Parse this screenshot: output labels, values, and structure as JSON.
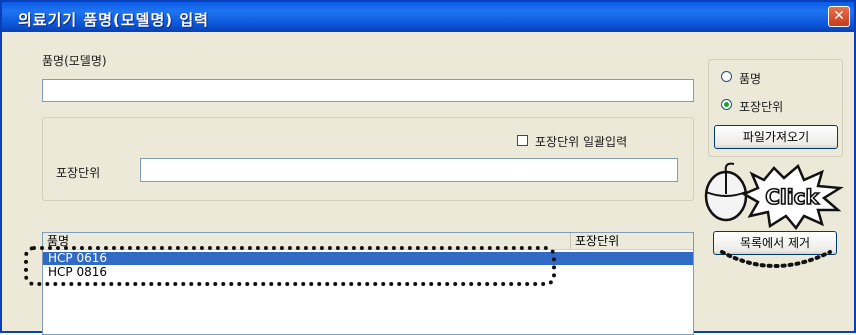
{
  "window": {
    "title": "의료기기 품명(모델명) 입력",
    "close_glyph": "✕"
  },
  "model_section": {
    "label": "품명(모델명)",
    "value": ""
  },
  "radio_group": {
    "options": [
      {
        "label": "품명",
        "checked": false
      },
      {
        "label": "포장단위",
        "checked": true
      }
    ]
  },
  "file_button_label": "파일가져오기",
  "package_group": {
    "bulk_checkbox_label": "포장단위 일괄입력",
    "bulk_checked": false,
    "unit_label": "포장단위",
    "unit_value": ""
  },
  "list": {
    "columns": [
      "품명",
      "포장단위"
    ],
    "rows": [
      {
        "name": "HCP 0616",
        "unit": "",
        "selected": true
      },
      {
        "name": "HCP 0816",
        "unit": "",
        "selected": false
      }
    ]
  },
  "remove_button_label": "목록에서 제거",
  "annotation": {
    "click_text": "Click",
    "color": "#111111"
  },
  "colors": {
    "titlebar": "#0b56d8",
    "selection": "#316ac5",
    "dialog_bg": "#ece9d8"
  }
}
